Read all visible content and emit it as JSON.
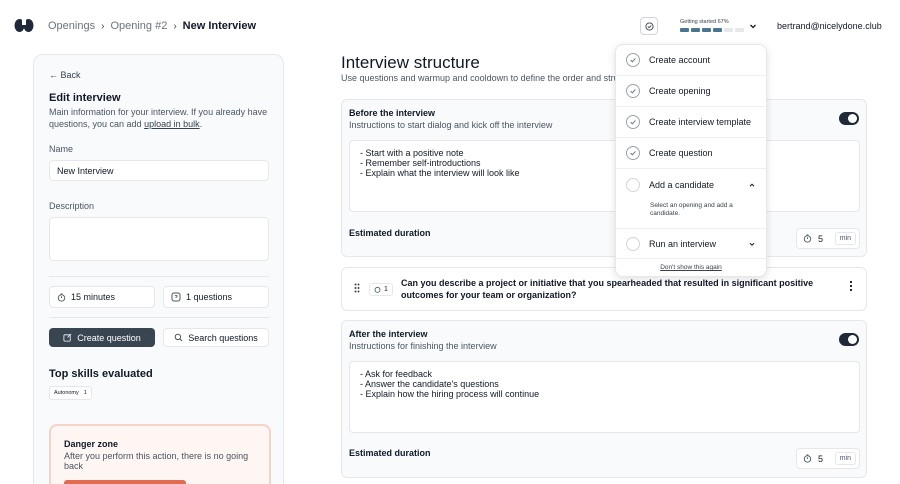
{
  "breadcrumb": {
    "items": [
      "Openings",
      "Opening #2"
    ],
    "current": "New Interview"
  },
  "getting_started": {
    "label": "Getting started 67%",
    "progress": 0.67,
    "segments_total": 6,
    "segments_done": 4,
    "items": [
      {
        "label": "Create account",
        "done": true
      },
      {
        "label": "Create opening",
        "done": true
      },
      {
        "label": "Create interview template",
        "done": true
      },
      {
        "label": "Create question",
        "done": true
      },
      {
        "label": "Add a candidate",
        "done": false,
        "expanded": true,
        "help": "Select an opening and add a candidate."
      },
      {
        "label": "Run an interview",
        "done": false,
        "expanded": false
      }
    ],
    "dismiss": "Don't show this again"
  },
  "user": {
    "email": "bertrand@nicelydone.club"
  },
  "left": {
    "back": "Back",
    "title": "Edit interview",
    "desc": "Main information for your interview. If you already have questions, you can add",
    "upload_link": "upload in bulk",
    "desc_end": ".",
    "name_label": "Name",
    "name_value": "New Interview",
    "desc_label": "Description",
    "duration": "15 minutes",
    "questions": "1 questions",
    "create_question": "Create question",
    "search_questions": "Search questions",
    "skills_title": "Top skills evaluated",
    "skills": [
      {
        "name": "Autonomy",
        "count": "1"
      }
    ],
    "danger_title": "Danger zone",
    "danger_desc": "After you perform this action, there is no going back"
  },
  "main": {
    "title": "Interview structure",
    "subtitle": "Use questions and warmup and cooldown to define the order and structure of your interview.",
    "before": {
      "title": "Before the interview",
      "sub": "Instructions to start dialog and kick off the interview",
      "lines": [
        "- Start with a positive note",
        "- Remember self-introductions",
        "- Explain what the interview will look like"
      ],
      "est_label": "Estimated duration",
      "duration": "5",
      "unit": "min"
    },
    "question": {
      "number": "1",
      "text": "Can you describe a project or initiative that you spearheaded that resulted in significant positive outcomes for your team or organization?"
    },
    "after": {
      "title": "After the interview",
      "sub": "Instructions for finishing the interview",
      "lines": [
        "- Ask for feedback",
        "- Answer the candidate's questions",
        "- Explain how the hiring process will continue"
      ],
      "est_label": "Estimated duration",
      "duration": "5",
      "unit": "min"
    }
  }
}
